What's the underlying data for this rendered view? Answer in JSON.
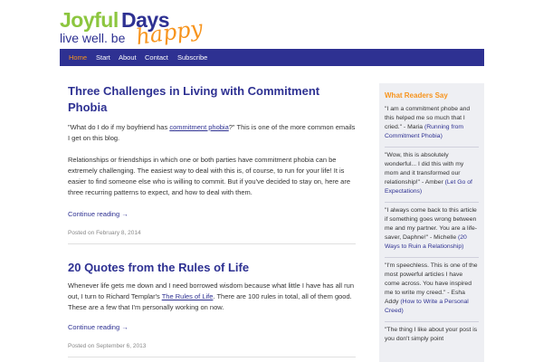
{
  "logo": {
    "word1": "Joyful",
    "word2": "Days",
    "tagline": "live well. be",
    "script": "happy"
  },
  "nav": [
    "Home",
    "Start",
    "About",
    "Contact",
    "Subscribe"
  ],
  "posts": [
    {
      "title": "Three Challenges in Living with Commitment Phobia",
      "p1_before": "\"What do I do if my boyfriend has ",
      "p1_link": "commitment phobia",
      "p1_after": "?\" This is one of the more common emails I get on this blog.",
      "p2": "Relationships or friendships in which one or both parties have commitment phobia can be extremely challenging. The easiest way to deal with this is, of course, to run for your life! It is easier to find someone else who is willing to commit. But if you've decided to stay on, here are three recurring patterns to expect, and how to deal with them.",
      "more": "Continue reading →",
      "meta": "Posted on February 8, 2014"
    },
    {
      "title": "20 Quotes from the Rules of Life",
      "p1_before": "Whenever life gets me down and I need borrowed wisdom because what little I have has all run out, I turn to Richard Templar's ",
      "p1_link": "The Rules of Life",
      "p1_after": ". There are 100 rules in total, all of them good. These are a few that I'm personally working on now.",
      "more": "Continue reading →",
      "meta": "Posted on September 6, 2013"
    }
  ],
  "sidebar": {
    "heading": "What Readers Say",
    "testimonials": [
      {
        "quote": "\"I am a commitment phobe and this helped me so much that I cried.\" - Maria ",
        "link": "(Running from Commitment Phobia)"
      },
      {
        "quote": "\"Wow, this is absolutely wonderful... I did this with my mom and it transformed our relationship!\" - Amber ",
        "link": "(Let Go of Expectations)"
      },
      {
        "quote": "\"I always come back to this article if something goes wrong between me and my partner. You are a life-saver, Daphne!\" - Michelle ",
        "link": "(20 Ways to Ruin a Relationship)"
      },
      {
        "quote": "\"I'm speechless. This is one of the most powerful articles I have come across. You have inspired me to write my creed.\" - Esha Addy ",
        "link": "(How to Write a Personal Creed)"
      },
      {
        "quote": "\"The thing I like about your post is you don't simply point",
        "link": ""
      }
    ]
  },
  "colors": {
    "brand_blue": "#2e3192",
    "brand_green": "#8cc63f",
    "brand_orange": "#f7941d",
    "sidebar_bg": "#eeeff3"
  }
}
